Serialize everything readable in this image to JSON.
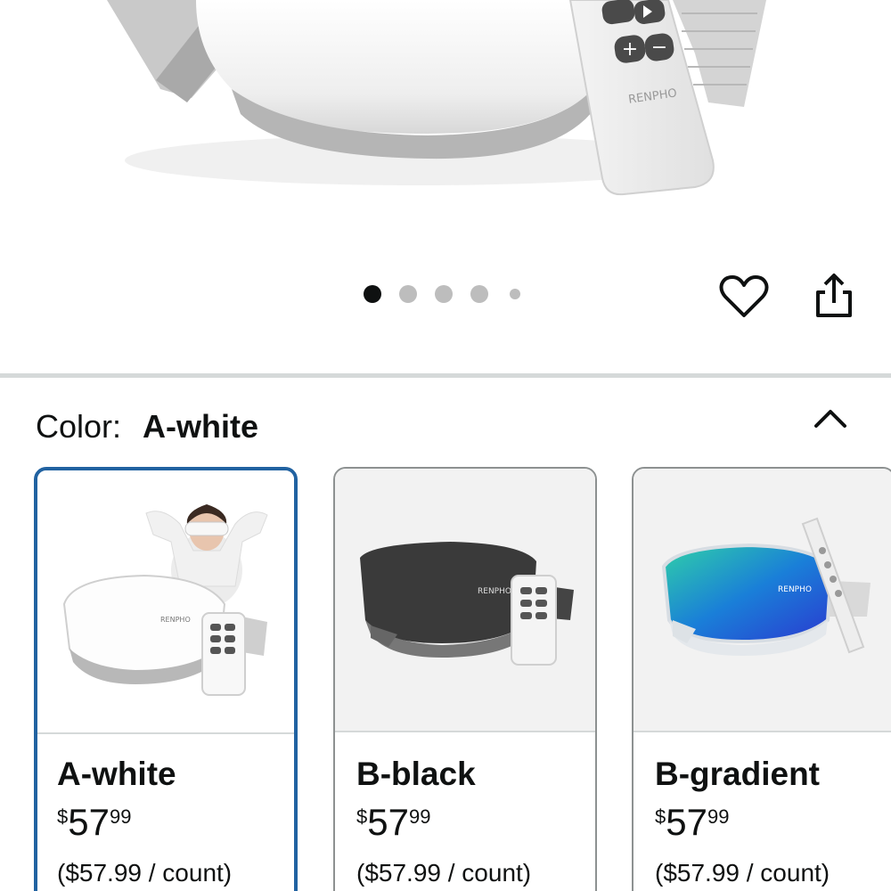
{
  "product": {
    "brand": "RENPHO",
    "remote_icons": [
      "play-pause-icon",
      "plus-icon",
      "minus-icon"
    ]
  },
  "carousel": {
    "total": 5,
    "active_index": 0
  },
  "actions": {
    "wishlist_icon": "heart-icon",
    "share_icon": "share-icon"
  },
  "color_selector": {
    "label": "Color:",
    "selected": "A-white",
    "collapse_icon": "chevron-up-icon"
  },
  "swatches": [
    {
      "name": "A-white",
      "price_symbol": "$",
      "price_whole": "57",
      "price_fraction": "99",
      "unit_price": "($57.99 / count)",
      "selected": true,
      "brand": "RENPHO"
    },
    {
      "name": "B-black",
      "price_symbol": "$",
      "price_whole": "57",
      "price_fraction": "99",
      "unit_price": "($57.99 / count)",
      "selected": false,
      "brand": "RENPHO"
    },
    {
      "name": "B-gradient",
      "price_symbol": "$",
      "price_whole": "57",
      "price_fraction": "99",
      "unit_price": "($57.99 / count)",
      "selected": false,
      "brand": "RENPHO"
    }
  ],
  "colors": {
    "selected_border": "#2162a1",
    "border": "#8d9191",
    "divider": "#d5d9d9",
    "dot_active": "#0f1111",
    "dot_inactive": "#bdbdbd"
  }
}
